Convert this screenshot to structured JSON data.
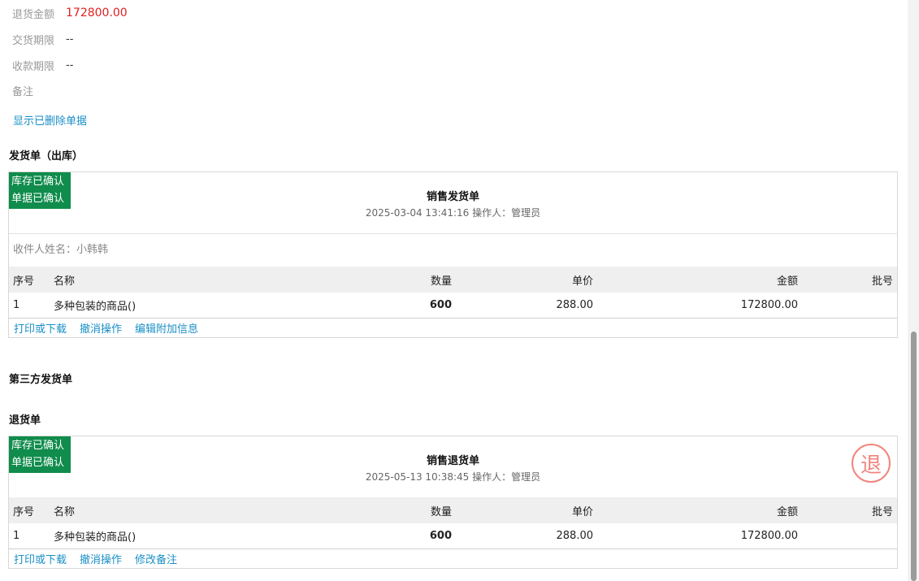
{
  "summary": {
    "refund_label": "退货金额",
    "refund_value": "172800.00",
    "delivery_term_label": "交货期限",
    "delivery_term_value": "--",
    "payment_term_label": "收款期限",
    "payment_term_value": "--",
    "remark_label": "备注",
    "remark_value": "",
    "show_deleted_link": "显示已删除单据"
  },
  "sections": {
    "shipping_title": "发货单（出库）",
    "third_party_title": "第三方发货单",
    "return_title": "退货单"
  },
  "shipping_doc": {
    "badge_line1": "库存已确认",
    "badge_line2": "单据已确认",
    "title": "销售发货单",
    "subtitle": "2025-03-04 13:41:16 操作人：管理员",
    "recipient": "收件人姓名：小韩韩",
    "columns": [
      "序号",
      "名称",
      "数量",
      "单价",
      "金额",
      "批号"
    ],
    "rows": [
      {
        "no": "1",
        "name": "多种包装的商品()",
        "qty": "600",
        "price": "288.00",
        "amount": "172800.00",
        "batch": ""
      }
    ],
    "actions": [
      "打印或下载",
      "撤消操作",
      "编辑附加信息"
    ]
  },
  "return_doc": {
    "badge_line1": "库存已确认",
    "badge_line2": "单据已确认",
    "title": "销售退货单",
    "subtitle": "2025-05-13 10:38:45 操作人：管理员",
    "stamp": "退",
    "columns": [
      "序号",
      "名称",
      "数量",
      "单价",
      "金额",
      "批号"
    ],
    "rows": [
      {
        "no": "1",
        "name": "多种包装的商品()",
        "qty": "600",
        "price": "288.00",
        "amount": "172800.00",
        "batch": ""
      }
    ],
    "actions": [
      "打印或下载",
      "撤消操作",
      "修改备注"
    ]
  },
  "colors": {
    "accent_link": "#1a8fc7",
    "badge_green": "#108c4c",
    "amount_red": "#e02020",
    "stamp_pink": "#f1857d"
  }
}
